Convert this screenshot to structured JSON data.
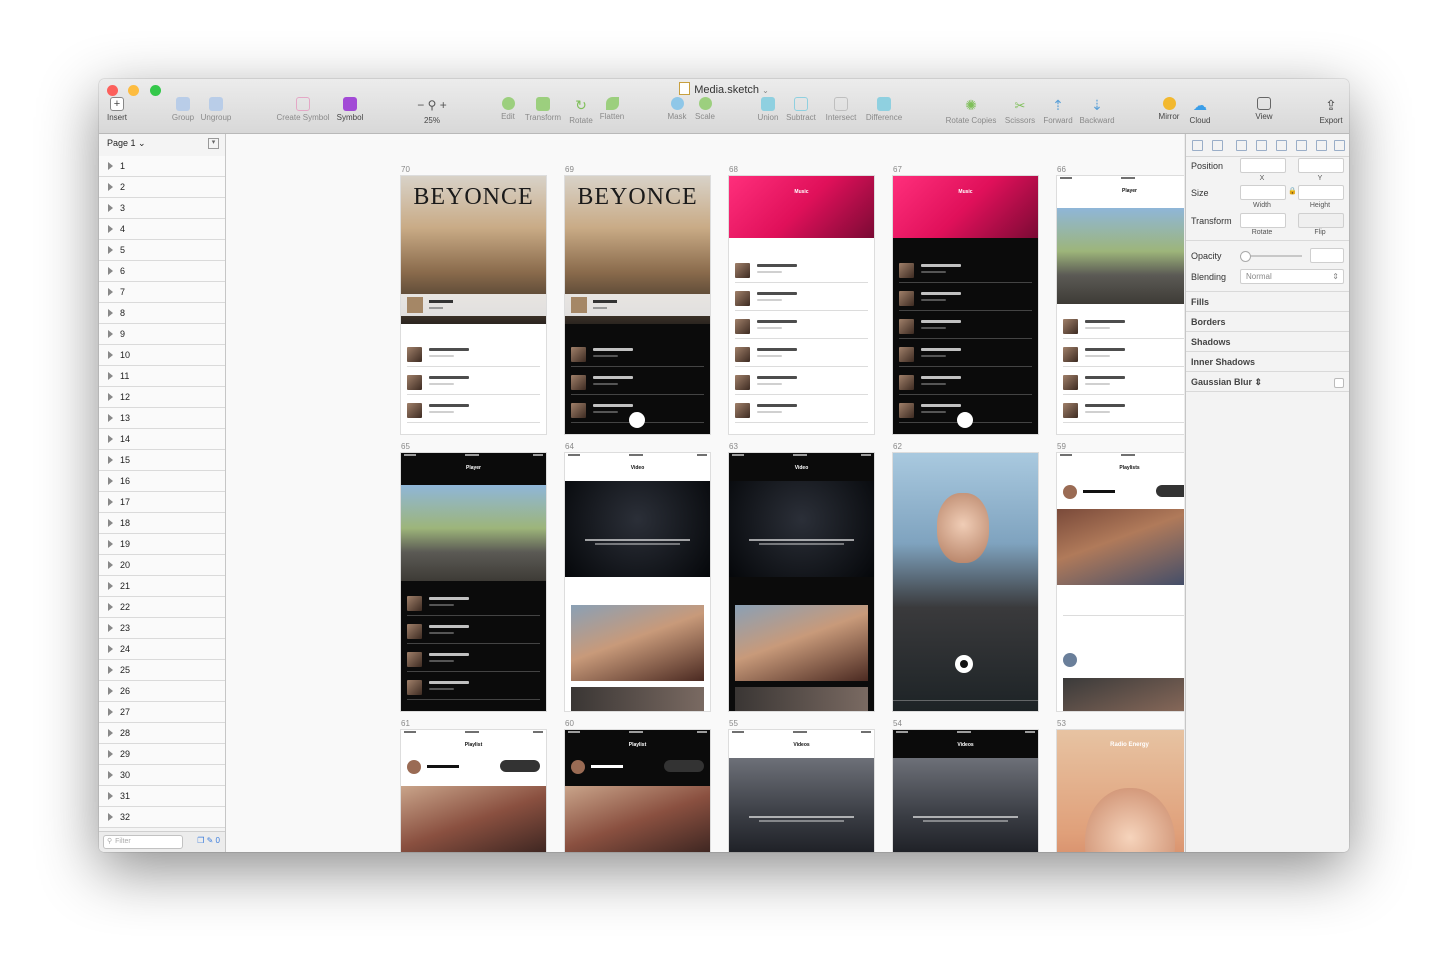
{
  "window": {
    "title": "Media.sketch",
    "traffic_lights": [
      "#fc605c",
      "#fdbc40",
      "#34c84a"
    ]
  },
  "toolbar": {
    "items": [
      {
        "label": "Insert",
        "icon": "plus-icon"
      },
      {
        "label": "Group",
        "icon": "group-icon"
      },
      {
        "label": "Ungroup",
        "icon": "ungroup-icon"
      },
      {
        "label": "Create Symbol",
        "icon": "create-symbol-icon"
      },
      {
        "label": "Symbol",
        "icon": "symbol-icon"
      },
      {
        "label": "25%",
        "icon": "zoom-icon"
      },
      {
        "label": "Edit",
        "icon": "edit-icon"
      },
      {
        "label": "Transform",
        "icon": "transform-icon"
      },
      {
        "label": "Rotate",
        "icon": "rotate-icon"
      },
      {
        "label": "Flatten",
        "icon": "flatten-icon"
      },
      {
        "label": "Mask",
        "icon": "mask-icon"
      },
      {
        "label": "Scale",
        "icon": "scale-icon"
      },
      {
        "label": "Union",
        "icon": "union-icon"
      },
      {
        "label": "Subtract",
        "icon": "subtract-icon"
      },
      {
        "label": "Intersect",
        "icon": "intersect-icon"
      },
      {
        "label": "Difference",
        "icon": "difference-icon"
      },
      {
        "label": "Rotate Copies",
        "icon": "rotate-copies-icon"
      },
      {
        "label": "Scissors",
        "icon": "scissors-icon"
      },
      {
        "label": "Forward",
        "icon": "forward-icon"
      },
      {
        "label": "Backward",
        "icon": "backward-icon"
      },
      {
        "label": "Mirror",
        "icon": "mirror-icon"
      },
      {
        "label": "Cloud",
        "icon": "cloud-icon"
      },
      {
        "label": "View",
        "icon": "view-icon"
      },
      {
        "label": "Export",
        "icon": "export-icon"
      }
    ]
  },
  "sidebar": {
    "page_selector": "Page 1",
    "layers": [
      "1",
      "2",
      "3",
      "4",
      "5",
      "6",
      "7",
      "8",
      "9",
      "10",
      "11",
      "12",
      "13",
      "14",
      "15",
      "16",
      "17",
      "18",
      "19",
      "20",
      "21",
      "22",
      "23",
      "24",
      "25",
      "26",
      "27",
      "28",
      "29",
      "30",
      "31",
      "32"
    ],
    "filter_placeholder": "Filter",
    "footer_count": "0"
  },
  "canvas": {
    "artboards": [
      {
        "label": "70",
        "theme": "light",
        "header": "Beyonce"
      },
      {
        "label": "69",
        "theme": "dark",
        "header": "Beyonce"
      },
      {
        "label": "68",
        "theme": "light",
        "header": "Music"
      },
      {
        "label": "67",
        "theme": "dark",
        "header": "Music"
      },
      {
        "label": "66",
        "theme": "light",
        "header": "Player"
      },
      {
        "label": "65",
        "theme": "dark",
        "header": "Player"
      },
      {
        "label": "64",
        "theme": "light",
        "header": "Video"
      },
      {
        "label": "63",
        "theme": "dark",
        "header": "Video"
      },
      {
        "label": "62",
        "theme": "photo",
        "header": ""
      },
      {
        "label": "59",
        "theme": "light",
        "header": "Playlists"
      },
      {
        "label": "61",
        "theme": "light",
        "header": "Playlist"
      },
      {
        "label": "60",
        "theme": "dark",
        "header": "Playlist"
      },
      {
        "label": "55",
        "theme": "light",
        "header": "Videos"
      },
      {
        "label": "54",
        "theme": "dark",
        "header": "Videos"
      },
      {
        "label": "53",
        "theme": "photo",
        "header": "Radio Energy"
      }
    ]
  },
  "inspector": {
    "position_label": "Position",
    "size_label": "Size",
    "transform_label": "Transform",
    "x_label": "X",
    "y_label": "Y",
    "width_label": "Width",
    "height_label": "Height",
    "rotate_label": "Rotate",
    "flip_label": "Flip",
    "opacity_label": "Opacity",
    "blending_label": "Blending",
    "blending_value": "Normal",
    "sections": [
      "Fills",
      "Borders",
      "Shadows",
      "Inner Shadows",
      "Gaussian Blur"
    ]
  }
}
